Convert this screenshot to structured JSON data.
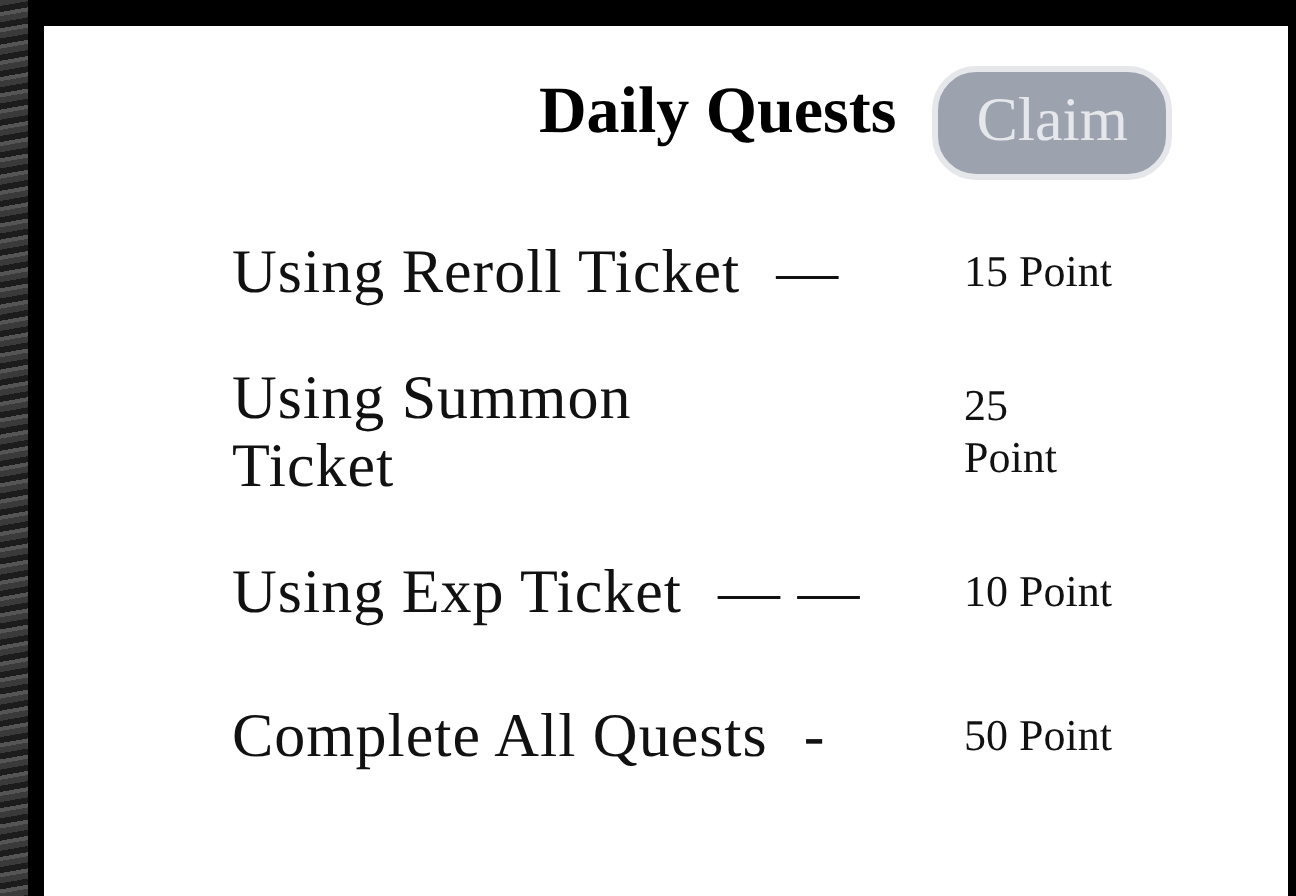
{
  "title": "Daily Quests",
  "claim_button": {
    "label": "Claim",
    "disabled": true
  },
  "quests": [
    {
      "name": "Using Reroll Ticket",
      "dash": "—",
      "points": "15 Point",
      "wrapped": false
    },
    {
      "name": "Using Summon Ticket",
      "points": "25 Point",
      "wrapped": true
    },
    {
      "name": "Using Exp Ticket",
      "dash": "— —",
      "points": "10 Point",
      "wrapped": false
    },
    {
      "name": "Complete All Quests",
      "dash": "-",
      "points": "50 Point",
      "wrapped": false
    }
  ]
}
